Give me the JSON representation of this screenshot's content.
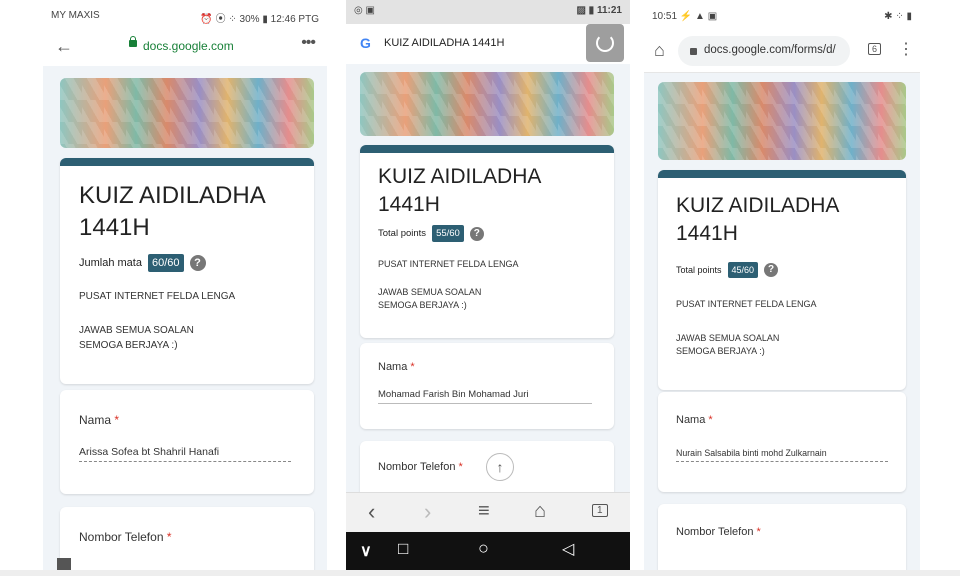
{
  "phones": [
    {
      "status": {
        "carrier": "MY MAXIS",
        "right": "⏰ ⦿ ⁘ 30% ▮ 12:46 PTG"
      },
      "address": {
        "domain": "docs.google.com",
        "back_icon": "arrow-left-icon",
        "menu_icon": "more-dots-icon"
      },
      "form": {
        "title": "KUIZ AIDILADHA\n1441H",
        "points_label": "Jumlah mata",
        "points_value": "60/60",
        "org": "PUSAT INTERNET FELDA LENGA",
        "instructions": "JAWAB SEMUA SOALAN\nSEMOGA BERJAYA :)",
        "q1_label": "Nama",
        "q1_answer": "Arissa Sofea bt Shahril Hanafi",
        "q2_label": "Nombor Telefon"
      }
    },
    {
      "status": {
        "left": "◎ ▣",
        "right": "▨ ▮ 11:21"
      },
      "address": {
        "title": "KUIZ AIDILADHA 1441H",
        "google_icon": "google-g-icon",
        "refresh_icon": "refresh-icon"
      },
      "form": {
        "title": "KUIZ AIDILADHA\n1441H",
        "points_label": "Total points",
        "points_value": "55/60",
        "org": "PUSAT INTERNET FELDA LENGA",
        "instructions": "JAWAB SEMUA SOALAN\nSEMOGA BERJAYA :)",
        "q1_label": "Nama",
        "q1_answer": "Mohamad Farish Bin Mohamad Juri",
        "q2_label": "Nombor Telefon"
      },
      "nav": {
        "back": "‹",
        "forward": "›",
        "menu": "≡",
        "home": "⌂",
        "tabs": "1"
      },
      "sysnav": {
        "down": "∨",
        "recents": "□",
        "home": "○",
        "back": "◁"
      }
    },
    {
      "status": {
        "left": "10:51 ⚡ ▲ ▣",
        "right": "✱ ⁘ ▮"
      },
      "address": {
        "domain": "docs.google.com/forms/d/",
        "tabs": "6",
        "home_icon": "home-icon",
        "menu_icon": "more-vertical-icon"
      },
      "form": {
        "title": "KUIZ AIDILADHA\n1441H",
        "points_label": "Total points",
        "points_value": "45/60",
        "org": "PUSAT INTERNET FELDA LENGA",
        "instructions": "JAWAB SEMUA SOALAN\nSEMOGA BERJAYA :)",
        "q1_label": "Nama",
        "q1_answer": "Nurain Salsabila binti mohd Zulkarnain",
        "q2_label": "Nombor Telefon"
      }
    }
  ],
  "required_mark": "*",
  "help_mark": "?",
  "colors": {
    "accent": "#2d5f73",
    "required": "#d93025",
    "lock": "#188038",
    "page_bg": "#f0f4f8"
  }
}
